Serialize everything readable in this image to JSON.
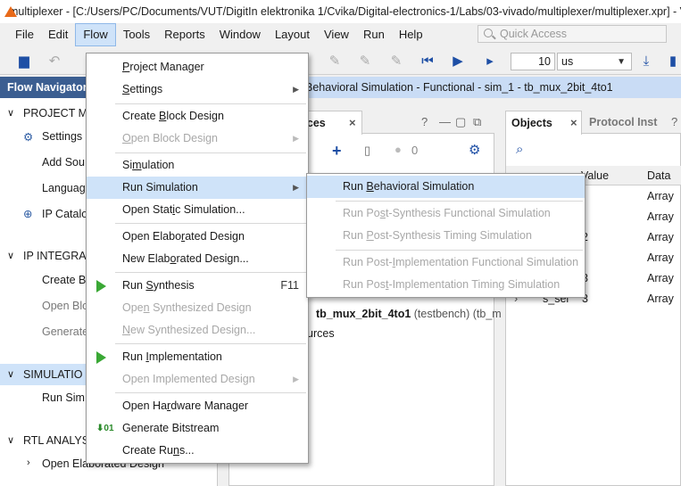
{
  "window": {
    "title": "multiplexer - [C:/Users/PC/Documents/VUT/DigitIn elektronika 1/Cvika/Digital-electronics-1/Labs/03-vivado/multiplexer/multiplexer.xpr] - V"
  },
  "menubar": {
    "items": [
      "File",
      "Edit",
      "Flow",
      "Tools",
      "Reports",
      "Window",
      "Layout",
      "View",
      "Run",
      "Help"
    ],
    "quick_access_placeholder": "Quick Access"
  },
  "toolbar": {
    "run_time_value": "10",
    "run_time_unit": "us"
  },
  "flow_navigator": {
    "header": "Flow Navigator",
    "project_manager": "PROJECT M",
    "settings": "Settings",
    "add_sources": "Add Sou",
    "language_templates": "Languag",
    "ip_catalog": "IP Catalo",
    "ip_integrator": "IP INTEGRAT",
    "create_block": "Create B",
    "open_block": "Open Blo",
    "generate_block": "Generate",
    "simulation": "SIMULATIO",
    "run_simulation": "Run Sim",
    "rtl_analysis": "RTL ANALYS",
    "open_elaborated": "Open Elaborated Design"
  },
  "simulation_header": "Behavioral Simulation - Functional - sim_1 - tb_mux_2bit_4to1",
  "sources_panel": {
    "tab": "rces",
    "badge_count": "0",
    "tree_item_name": "tb_mux_2bit_4to1",
    "tree_item_detail": "(testbench) (tb_m",
    "sources_label": "urces"
  },
  "objects_panel": {
    "tab_objects": "Objects",
    "tab_protocol": "Protocol Inst",
    "columns": [
      "Value",
      "Data Ty"
    ],
    "rows": [
      {
        "value": "",
        "type": "Array"
      },
      {
        "value": "",
        "type": "Array"
      },
      {
        "value": "2",
        "type": "Array"
      },
      {
        "value": "",
        "type": "Array"
      },
      {
        "value": "3",
        "type": "Array"
      },
      {
        "value": "3",
        "type": "Array"
      }
    ],
    "last_row_name": "s_sel"
  },
  "flow_menu": {
    "items": [
      {
        "pre": "",
        "u": "P",
        "post": "roject Manager"
      },
      {
        "pre": "",
        "u": "S",
        "post": "ettings"
      },
      {
        "pre": "Create ",
        "u": "B",
        "post": "lock Design"
      },
      {
        "pre": "",
        "u": "O",
        "post": "pen Block Design"
      },
      {
        "pre": "Si",
        "u": "m",
        "post": "ulation"
      },
      {
        "pre": "Run Simulation",
        "u": "",
        "post": ""
      },
      {
        "pre": "Open Stat",
        "u": "i",
        "post": "c Simulation..."
      },
      {
        "pre": "Open Elabo",
        "u": "r",
        "post": "ated Design"
      },
      {
        "pre": "New Elab",
        "u": "o",
        "post": "rated Design..."
      },
      {
        "pre": "Run ",
        "u": "S",
        "post": "ynthesis"
      },
      {
        "pre": "Ope",
        "u": "n",
        "post": " Synthesized Design"
      },
      {
        "pre": "",
        "u": "N",
        "post": "ew Synthesized Design..."
      },
      {
        "pre": "Run ",
        "u": "I",
        "post": "mplementation"
      },
      {
        "pre": "Open Implemented Design",
        "u": "",
        "post": ""
      },
      {
        "pre": "Open Ha",
        "u": "r",
        "post": "dware Manager"
      },
      {
        "pre": "Generate Bitstream",
        "u": "",
        "post": ""
      },
      {
        "pre": "Create Ru",
        "u": "n",
        "post": "s..."
      }
    ],
    "synthesis_shortcut": "F11"
  },
  "run_sim_submenu": {
    "items": [
      {
        "pre": "Run ",
        "u": "B",
        "post": "ehavioral Simulation"
      },
      {
        "pre": "Run Po",
        "u": "s",
        "post": "t-Synthesis Functional Simulation"
      },
      {
        "pre": "Run ",
        "u": "P",
        "post": "ost-Synthesis Timing Simulation"
      },
      {
        "pre": "Run Post-",
        "u": "I",
        "post": "mplementation Functional Simulation"
      },
      {
        "pre": "Run Pos",
        "u": "t",
        "post": "-Implementation Timing Simulation"
      }
    ]
  },
  "colors": {
    "flow_nav_header": "#3b5e91",
    "highlight": "#cfe3f9",
    "run_icon_green": "#3aa835",
    "toolbar_blue": "#1e4fa5"
  }
}
